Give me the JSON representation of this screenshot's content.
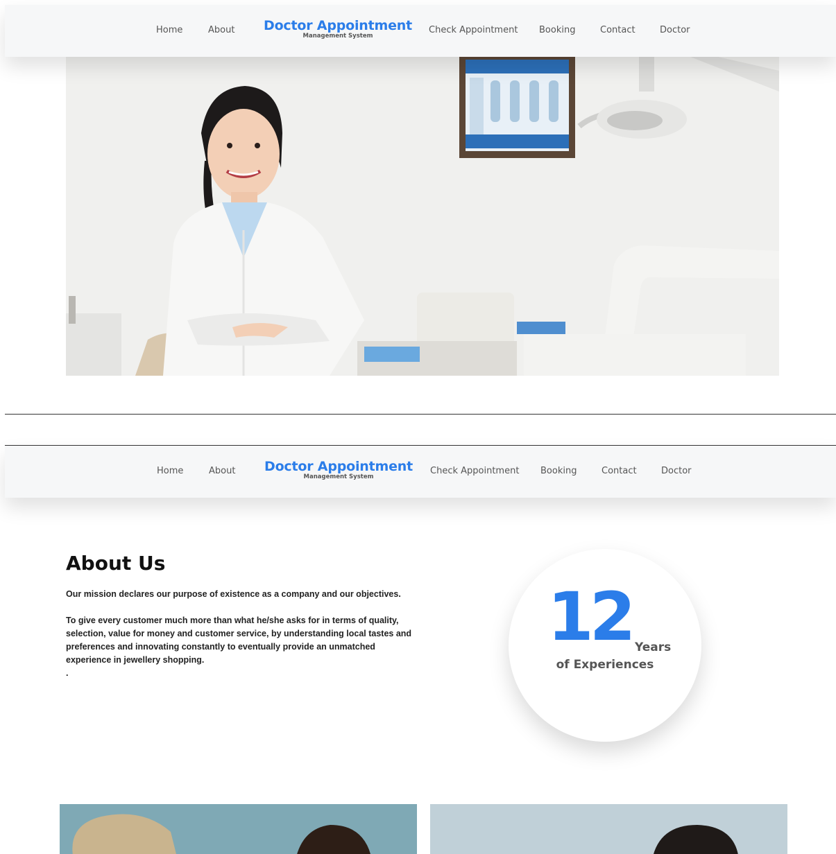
{
  "nav": {
    "home": "Home",
    "about": "About",
    "brand_title": "Doctor Appointment",
    "brand_sub": "Management System",
    "check": "Check Appointment",
    "booking": "Booking",
    "contact": "Contact",
    "doctor": "Doctor"
  },
  "about": {
    "title": "About Us",
    "p1": "Our mission declares our purpose of existence as a company and our objectives.",
    "p2": "To give every customer much more than what he/she asks for in terms of quality, selection, value for money and customer service, by understanding local tastes and preferences and innovating constantly to eventually provide an unmatched experience in jewellery shopping.",
    "p3": "."
  },
  "stats": {
    "number": "12",
    "unit": "Years",
    "label": "of Experiences"
  },
  "colors": {
    "brand": "#2b7de9",
    "nav_bg": "#f6f7f8"
  }
}
